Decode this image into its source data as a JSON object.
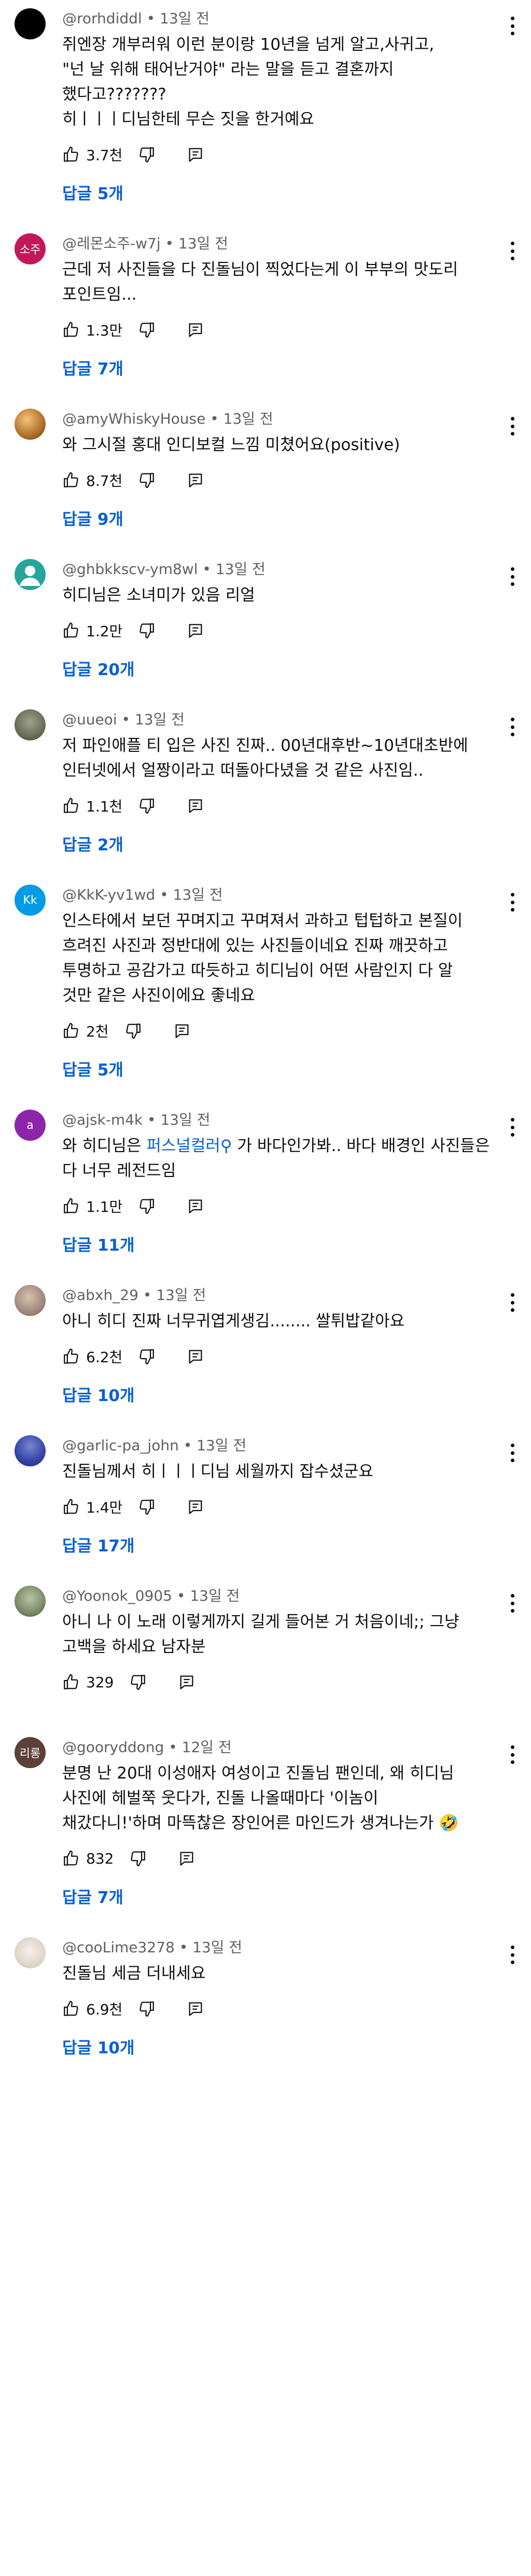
{
  "colors": {
    "link": "#065fd4",
    "meta": "#606060",
    "text": "#0f0f0f"
  },
  "comments": [
    {
      "handle": "@rorhdiddl",
      "time": "13일 전",
      "avatar_color": "#000000",
      "avatar_text": "",
      "text": "쥐엔장 개부러워 이런 분이랑 10년을 넘게 알고,사귀고,\n\"넌 날 위해 태어난거야\" 라는 말을 듣고 결혼까지\n했다고???????\n히ㅣㅣㅣ디님한테 무슨 짓을 한거예요",
      "likes": "3.7천",
      "replies": "답글 5개"
    },
    {
      "handle": "@레몬소주-w7j",
      "time": "13일 전",
      "avatar_color": "#c2185b",
      "avatar_text": "소주",
      "text": "근데 저 사진들을 다 진돌님이 찍었다는게 이 부부의 맛도리\n포인트임...",
      "likes": "1.3만",
      "replies": "답글 7개"
    },
    {
      "handle": "@amyWhiskyHouse",
      "time": "13일 전",
      "avatar_color": "#b5762e",
      "avatar_text": "",
      "text": "와 그시절 홍대 인디보컬 느낌 미쳤어요(positive)",
      "likes": "8.7천",
      "replies": "답글 9개"
    },
    {
      "handle": "@ghbkkscv-ym8wl",
      "time": "13일 전",
      "avatar_color": "#26a69a",
      "avatar_text": "",
      "text": "히디님은 소녀미가 있음 리얼",
      "likes": "1.2만",
      "replies": "답글 20개"
    },
    {
      "handle": "@uueoi",
      "time": "13일 전",
      "avatar_color": "#6d6d5a",
      "avatar_text": "",
      "text": "저 파인애플 티 입은 사진 진짜.. 00년대후반~10년대초반에\n인터넷에서 얼짱이라고 떠돌아다녔을 것 같은 사진임..",
      "likes": "1.1천",
      "replies": "답글 2개"
    },
    {
      "handle": "@KkK-yv1wd",
      "time": "13일 전",
      "avatar_color": "#039be5",
      "avatar_text": "Kk",
      "text": "인스타에서 보던 꾸며지고 꾸며져서 과하고 텁텁하고 본질이\n흐려진 사진과 정반대에 있는 사진들이네요 진짜 깨끗하고\n투명하고 공감가고 따듯하고 히디님이 어떤 사람인지 다 알\n것만 같은 사진이에요 좋네요",
      "likes": "2천",
      "replies": "답글 5개"
    },
    {
      "handle": "@ajsk-m4k",
      "time": "13일 전",
      "avatar_color": "#8e24aa",
      "avatar_text": "a",
      "text_before": "와 히디님은 ",
      "mention": "퍼스널컬러",
      "text_after": " 가 바다인가봐.. 바다 배경인 사진들은\n다 너무 레전드임",
      "likes": "1.1만",
      "replies": "답글 11개"
    },
    {
      "handle": "@abxh_29",
      "time": "13일 전",
      "avatar_color": "#a1887f",
      "avatar_text": "",
      "text": "아니 히디 진짜 너무귀엽게생김........ 쌀튀밥같아요",
      "likes": "6.2천",
      "replies": "답글 10개"
    },
    {
      "handle": "@garlic-pa_john",
      "time": "13일 전",
      "avatar_color": "#3949ab",
      "avatar_text": "",
      "text": "진돌님께서 히ㅣㅣㅣ디님 세월까지 잡수셨군요",
      "likes": "1.4만",
      "replies": "답글 17개"
    },
    {
      "handle": "@Yoonok_0905",
      "time": "13일 전",
      "avatar_color": "#7b8a6a",
      "avatar_text": "",
      "text": "아니 나 이 노래 이렇게까지 길게 들어본 거 처음이네;; 그냥\n고백을 하세요 남자분",
      "likes": "329",
      "replies": ""
    },
    {
      "handle": "@gooryddong",
      "time": "12일 전",
      "avatar_color": "#5d4037",
      "avatar_text": "리롱",
      "text": "분명 난 20대 이성애자 여성이고 진돌님 팬인데, 왜 히디님\n사진에 헤벌쭉 웃다가, 진돌 나올때마다 '이놈이\n채갔다니!'하며 마뜩찮은 장인어른 마인드가 생겨나는가 🤣",
      "likes": "832",
      "replies": "답글 7개"
    },
    {
      "handle": "@cooLime3278",
      "time": "13일 전",
      "avatar_color": "#e0d6cc",
      "avatar_text": "",
      "text": "진돌님 세금 더내세요",
      "likes": "6.9천",
      "replies": "답글 10개"
    }
  ]
}
